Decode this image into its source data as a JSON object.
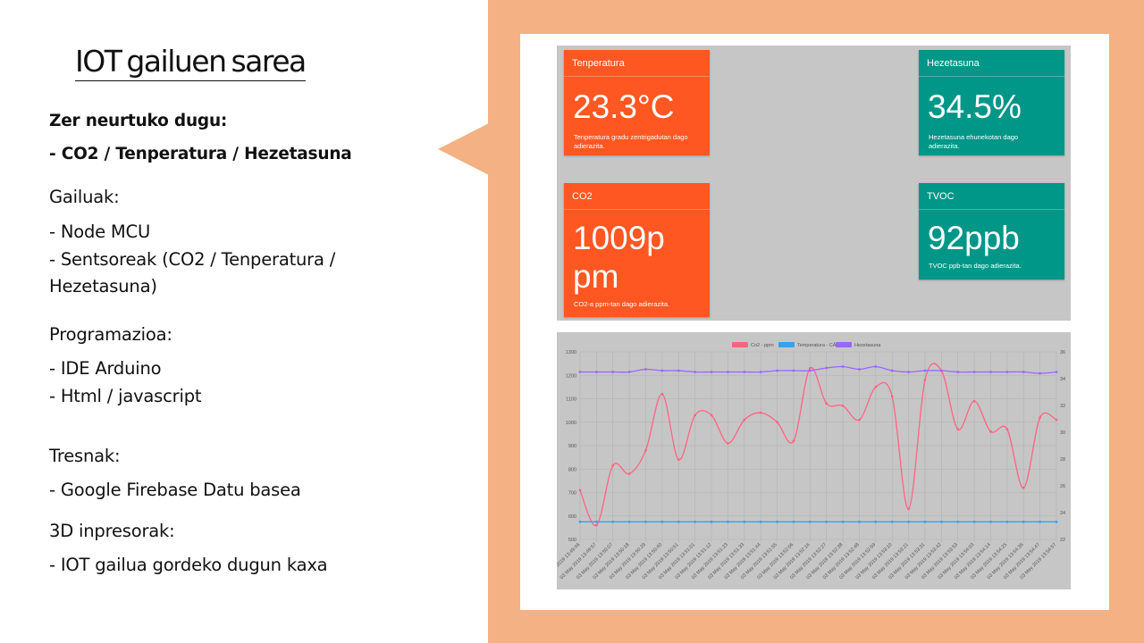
{
  "slide": {
    "title": "IOT gailuen sarea",
    "sections": [
      {
        "text": "Zer neurtuko dugu:",
        "bold": true
      },
      {
        "text": "- CO2 / Tenperatura / Hezetasuna",
        "bold": true
      },
      {
        "text": "Gailuak:",
        "bold": false
      },
      {
        "text": "- Node MCU",
        "bold": false
      },
      {
        "text": "- Sentsoreak (CO2 / Tenperatura  /",
        "bold": false
      },
      {
        "text": "Hezetasuna)",
        "bold": false
      },
      {
        "text": "Programazioa:",
        "bold": false
      },
      {
        "text": "- IDE Arduino",
        "bold": false
      },
      {
        "text": "- Html / javascript",
        "bold": false
      },
      {
        "text": "Tresnak:",
        "bold": false
      },
      {
        "text": "- Google Firebase Datu basea",
        "bold": false
      },
      {
        "text": "3D inpresorak:",
        "bold": false
      },
      {
        "text": "- IOT gailua gordeko dugun kaxa",
        "bold": false
      }
    ]
  },
  "dashboard": {
    "cards": [
      {
        "title": "Tenperatura",
        "value_lines": [
          "23.3°C"
        ],
        "desc_lines": [
          "Tenperatura gradu zentrigadutan dago",
          "adierazita."
        ],
        "color": "#ff5722"
      },
      {
        "title": "Hezetasuna",
        "value_lines": [
          "34.5%"
        ],
        "desc_lines": [
          "Hezetasuna ehunekotan dago",
          "adierazita."
        ],
        "color": "#009688"
      },
      {
        "title": "CO2",
        "value_lines": [
          "1009p",
          "pm"
        ],
        "desc_lines": [
          "CO2-a ppm-tan dago adierazita."
        ],
        "color": "#ff5722"
      },
      {
        "title": "TVOC",
        "value_lines": [
          "92ppb"
        ],
        "desc_lines": [
          "TVOC ppb-tan dago adierazita."
        ],
        "color": "#009688"
      }
    ]
  },
  "chart_data": {
    "type": "line",
    "legend_position": "top",
    "grid": true,
    "x": [
      "03 May 2019 13:49:46",
      "03 May 2019 13:49:57",
      "03 May 2019 13:50:07",
      "03 May 2019 13:50:18",
      "03 May 2019 13:50:29",
      "03 May 2019 13:50:40",
      "03 May 2019 13:50:51",
      "03 May 2019 13:51:01",
      "03 May 2019 13:51:12",
      "03 May 2019 13:51:23",
      "03 May 2019 13:51:33",
      "03 May 2019 13:51:44",
      "03 May 2019 13:51:55",
      "03 May 2019 13:52:06",
      "03 May 2019 13:52:16",
      "03 May 2019 13:52:27",
      "03 May 2019 13:52:38",
      "03 May 2019 13:52:48",
      "03 May 2019 13:52:59",
      "03 May 2019 13:53:10",
      "03 May 2019 13:53:21",
      "03 May 2019 13:53:31",
      "03 May 2019 13:53:42",
      "03 May 2019 13:53:53",
      "03 May 2019 13:54:03",
      "03 May 2019 13:54:14",
      "03 May 2019 13:54:25",
      "03 May 2019 13:54:36",
      "03 May 2019 13:54:47",
      "03 May 2019 13:54:57"
    ],
    "left_axis": {
      "ylim": [
        500,
        1300
      ],
      "ticks": [
        500,
        600,
        700,
        800,
        900,
        1000,
        1100,
        1200,
        1300
      ]
    },
    "right_axis": {
      "ylim": [
        22,
        36
      ],
      "ticks": [
        22,
        24,
        26,
        28,
        30,
        32,
        34,
        36
      ]
    },
    "series": [
      {
        "name": "Co2 - ppm",
        "axis": "left",
        "color": "#ff6384",
        "values": [
          710,
          560,
          815,
          780,
          880,
          1120,
          840,
          1030,
          1030,
          910,
          1010,
          1040,
          1000,
          920,
          1230,
          1080,
          1070,
          1010,
          1150,
          1110,
          630,
          1180,
          1220,
          970,
          1090,
          960,
          970,
          720,
          1020,
          1010
        ]
      },
      {
        "name": "Temperatura - CÂº",
        "axis": "left",
        "color": "#36a2eb",
        "values": [
          575,
          575,
          575,
          575,
          575,
          575,
          575,
          575,
          575,
          575,
          575,
          575,
          575,
          575,
          575,
          575,
          575,
          575,
          575,
          575,
          575,
          575,
          575,
          575,
          575,
          575,
          575,
          575,
          575,
          575
        ]
      },
      {
        "name": "Hezetasuna",
        "axis": "right",
        "color": "#9966ff",
        "values": [
          34.5,
          34.5,
          34.5,
          34.5,
          34.7,
          34.6,
          34.6,
          34.5,
          34.5,
          34.5,
          34.5,
          34.5,
          34.6,
          34.6,
          34.6,
          34.8,
          34.9,
          34.7,
          34.9,
          34.6,
          34.5,
          34.6,
          34.6,
          34.5,
          34.5,
          34.5,
          34.5,
          34.5,
          34.4,
          34.5
        ]
      }
    ]
  }
}
